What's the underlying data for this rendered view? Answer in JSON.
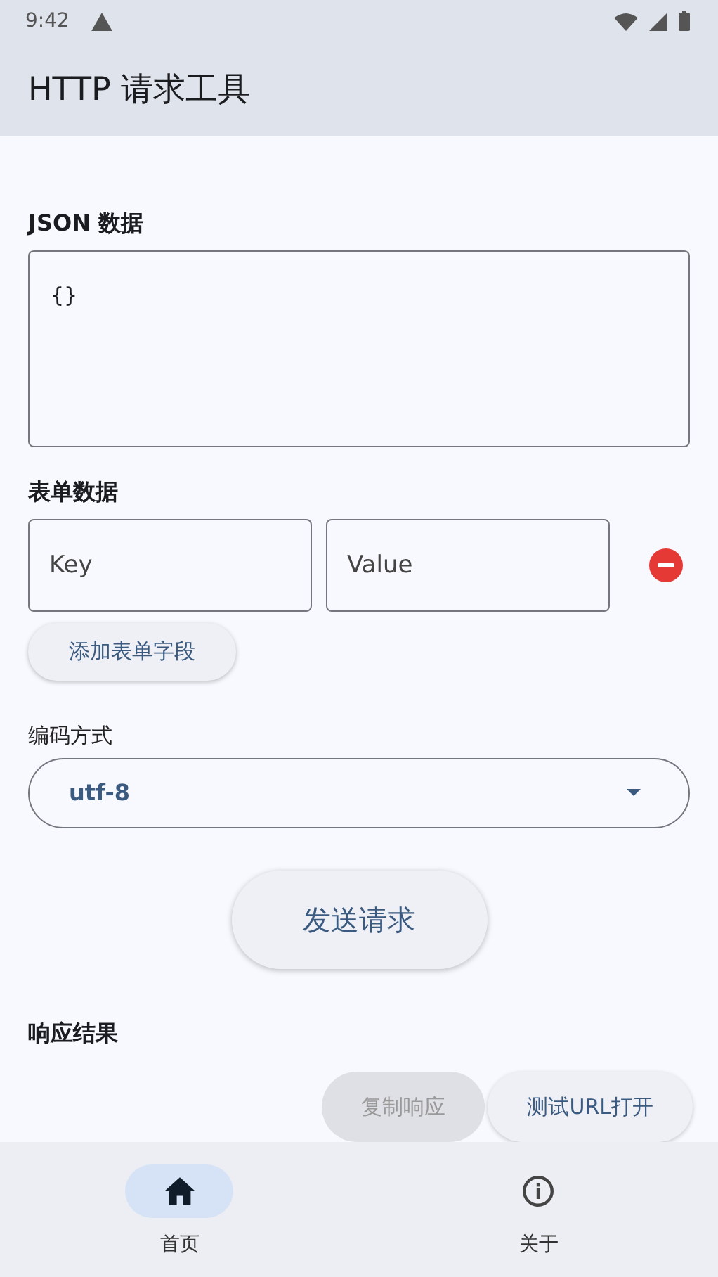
{
  "status_bar": {
    "time": "9:42"
  },
  "app_bar": {
    "title": "HTTP 请求工具"
  },
  "json_section": {
    "label": "JSON 数据",
    "value": "{}"
  },
  "form_section": {
    "label": "表单数据",
    "fields": [
      {
        "placeholder": "Key",
        "placeholder_2": "Value"
      }
    ],
    "add_button": "添加表单字段"
  },
  "encoding": {
    "label": "编码方式",
    "value": "utf-8"
  },
  "send_button": "发送请求",
  "response": {
    "label": "响应结果",
    "buttons": [
      {
        "label": "复制响应",
        "disabled": true
      },
      {
        "label": "测试URL打开",
        "disabled": false
      }
    ]
  },
  "bottom_nav": [
    {
      "label": "首页",
      "kind": "home",
      "selected": true
    },
    {
      "label": "关于",
      "kind": "info",
      "selected": false
    }
  ]
}
